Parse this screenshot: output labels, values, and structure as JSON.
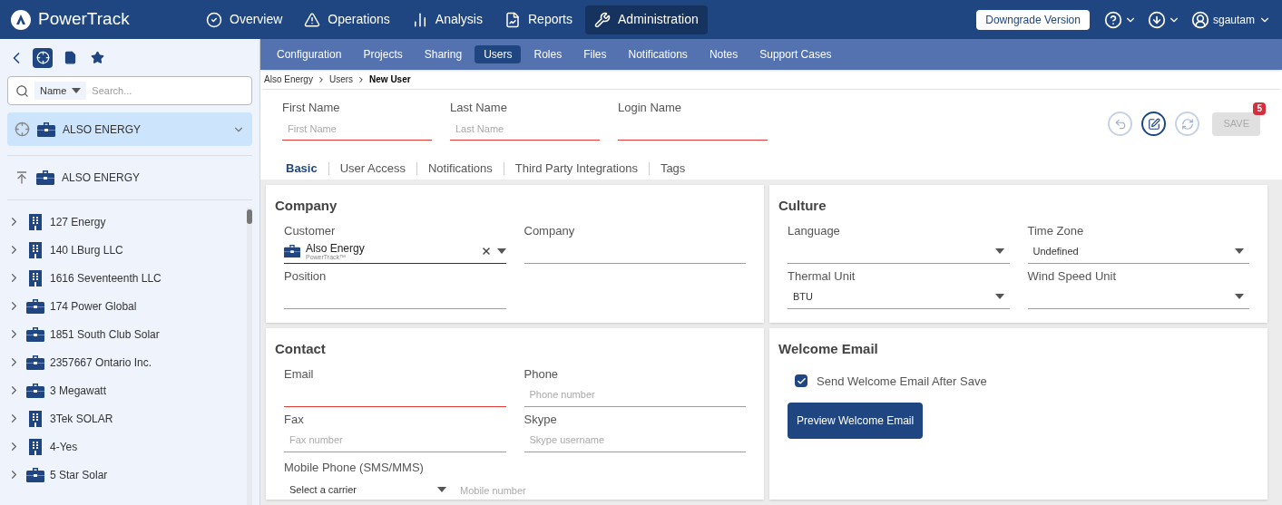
{
  "app": {
    "name": "PowerTrack"
  },
  "main_nav": [
    {
      "kind": "overview",
      "label": "Overview",
      "selected": false
    },
    {
      "kind": "operations",
      "label": "Operations",
      "selected": false
    },
    {
      "kind": "analysis",
      "label": "Analysis",
      "selected": false
    },
    {
      "kind": "reports",
      "label": "Reports",
      "selected": false
    },
    {
      "kind": "administration",
      "label": "Administration",
      "selected": true
    }
  ],
  "top_right": {
    "downgrade_button": "Downgrade Version",
    "user": "sgautam"
  },
  "sub_nav": [
    {
      "label": "Configuration",
      "selected": false
    },
    {
      "label": "Projects",
      "selected": false
    },
    {
      "label": "Sharing",
      "selected": false
    },
    {
      "label": "Users",
      "selected": true
    },
    {
      "label": "Roles",
      "selected": false
    },
    {
      "label": "Files",
      "selected": false
    },
    {
      "label": "Notifications",
      "selected": false
    },
    {
      "label": "Notes",
      "selected": false
    },
    {
      "label": "Support Cases",
      "selected": false
    }
  ],
  "sidebar": {
    "toolbar": [
      {
        "kind": "locate",
        "selected": true
      },
      {
        "kind": "document",
        "selected": false
      },
      {
        "kind": "star",
        "selected": false
      }
    ],
    "search": {
      "filter": "Name",
      "placeholder": "Search..."
    },
    "current": {
      "label": "ALSO ENERGY",
      "expanded": false
    },
    "pinned": {
      "label": "ALSO ENERGY"
    },
    "items": [
      {
        "kind": "building",
        "label": "127 Energy",
        "expanded": false
      },
      {
        "kind": "building",
        "label": "140 LBurg LLC",
        "expanded": false
      },
      {
        "kind": "building",
        "label": "1616 Seventeenth LLC",
        "expanded": false
      },
      {
        "kind": "briefcase",
        "label": "174 Power Global",
        "expanded": false
      },
      {
        "kind": "briefcase",
        "label": "1851 South Club Solar",
        "expanded": false
      },
      {
        "kind": "briefcase",
        "label": "2357667 Ontario Inc.",
        "expanded": false
      },
      {
        "kind": "briefcase",
        "label": "3 Megawatt",
        "expanded": false
      },
      {
        "kind": "building",
        "label": "3Tek SOLAR",
        "expanded": false
      },
      {
        "kind": "building",
        "label": "4-Yes",
        "expanded": false
      },
      {
        "kind": "briefcase",
        "label": "5 Star Solar",
        "expanded": false
      }
    ]
  },
  "breadcrumb": [
    {
      "label": "Also Energy",
      "current": false
    },
    {
      "label": "Users",
      "current": false
    },
    {
      "label": "New User",
      "current": true
    }
  ],
  "name_fields": [
    {
      "label": "First Name",
      "placeholder": "First Name",
      "invalid": true
    },
    {
      "label": "Last Name",
      "placeholder": "Last Name",
      "invalid": true
    },
    {
      "label": "Login Name",
      "invalid": true
    }
  ],
  "actions": [
    {
      "kind": "undo",
      "active": false
    },
    {
      "kind": "edit",
      "active": true
    },
    {
      "kind": "refresh",
      "active": false
    }
  ],
  "save": {
    "label": "SAVE",
    "disabled": true,
    "badge": "5"
  },
  "tabs": [
    {
      "label": "Basic",
      "selected": true
    },
    {
      "label": "User Access",
      "selected": false
    },
    {
      "label": "Notifications",
      "selected": false
    },
    {
      "label": "Third Party Integrations",
      "selected": false
    },
    {
      "label": "Tags",
      "selected": false
    }
  ],
  "company": {
    "title": "Company",
    "fields": [
      {
        "kind": "customer",
        "label": "Customer",
        "value": "Also Energy",
        "subtitle": "PowerTrack™",
        "invalid": false
      },
      {
        "kind": "text",
        "label": "Company",
        "invalid": false
      },
      {
        "kind": "text",
        "label": "Position",
        "invalid": false
      }
    ]
  },
  "culture": {
    "title": "Culture",
    "fields": [
      {
        "kind": "select",
        "label": "Language"
      },
      {
        "kind": "select",
        "label": "Time Zone",
        "value": "Undefined"
      },
      {
        "kind": "select",
        "label": "Thermal Unit",
        "value": "BTU"
      },
      {
        "kind": "select",
        "label": "Wind Speed Unit"
      }
    ]
  },
  "contact": {
    "title": "Contact",
    "fields": [
      {
        "label": "Email",
        "invalid": true
      },
      {
        "label": "Phone",
        "placeholder": "Phone number",
        "invalid": false
      },
      {
        "label": "Fax",
        "placeholder": "Fax number",
        "invalid": false
      },
      {
        "label": "Skype",
        "placeholder": "Skype username",
        "invalid": false
      }
    ],
    "mobile": {
      "label": "Mobile Phone (SMS/MMS)",
      "carrier": "Select a carrier",
      "placeholder": "Mobile number"
    }
  },
  "welcome": {
    "title": "Welcome Email",
    "checkbox": {
      "label": "Send Welcome Email After Save",
      "checked": true
    },
    "button": "Preview Welcome Email"
  }
}
